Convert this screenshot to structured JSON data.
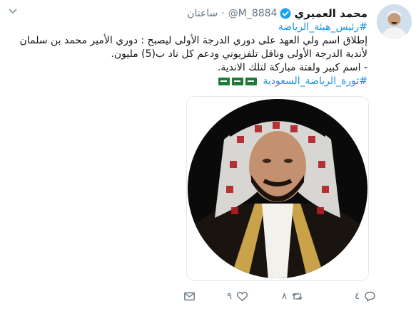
{
  "tweet": {
    "author_name": "محمد العميري",
    "handle": "@M_8884",
    "time": "ساعتان",
    "hashtag_top": "#رئيس_هيئة_الرياضة",
    "body_line1": "إطلاق اسم ولي العهد على دوري الدرجة الأولى ليصبح : دوري الأمير محمد بن سلمان",
    "body_line2": "لأندية الدرجة الأولى وناقل تلفزيوني ودعم كل ناد ب(5) مليون.",
    "body_line3": "- اسم كبير ولفتة مباركة لتلك الاندية.",
    "hashtag_bottom": "#ثورة_الرياضة_السعودية",
    "flags": [
      "saudi-flag",
      "saudi-flag",
      "saudi-flag"
    ]
  },
  "actions": {
    "reply_count": "٤",
    "retweet_count": "٨",
    "like_count": "٩"
  },
  "icons": {
    "chevron": "chevron-down-icon",
    "verified": "verified-badge-icon",
    "reply": "reply-icon",
    "retweet": "retweet-icon",
    "like": "heart-icon",
    "message": "envelope-icon"
  },
  "colors": {
    "link": "#1b95e0",
    "muted": "#657786",
    "verified": "#1da1f2",
    "flag_green": "#1f7a35"
  }
}
